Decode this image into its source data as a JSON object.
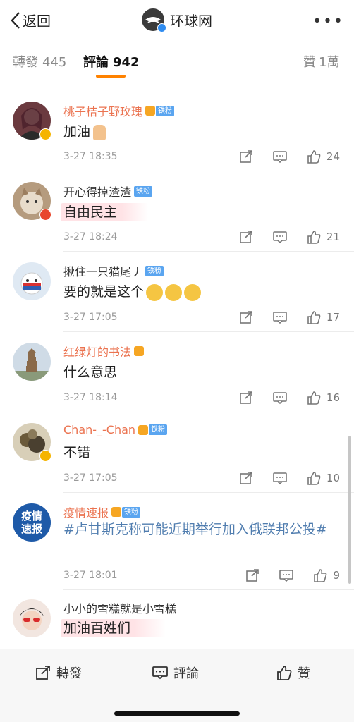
{
  "nav": {
    "back_label": "返回",
    "title": "环球网",
    "more": "•••"
  },
  "tabs": [
    {
      "label": "轉發",
      "count": "445"
    },
    {
      "label": "評論",
      "count": "942"
    },
    {
      "label": "贊",
      "count": "1萬"
    }
  ],
  "comments": [
    {
      "name": "桃子桔子野玫瑰",
      "fan_tag": "铁粉",
      "text": "加油",
      "time": "3-27 18:35",
      "likes": "24"
    },
    {
      "name": "开心得掉渣渣",
      "fan_tag": "铁粉",
      "text": "自由民主",
      "time": "3-27 18:24",
      "likes": "21"
    },
    {
      "name": "揪住一只猫尾丿",
      "fan_tag": "铁粉",
      "text": "要的就是这个",
      "time": "3-27 17:05",
      "likes": "17"
    },
    {
      "name": "红绿灯的书法",
      "text": "什么意思",
      "time": "3-27 18:14",
      "likes": "16"
    },
    {
      "name": "Chan-_-Chan",
      "fan_tag": "铁粉",
      "text": "不错",
      "time": "3-27 17:05",
      "likes": "10"
    },
    {
      "name": "疫情速报",
      "fan_tag": "铁粉",
      "avatar_text": "疫情\n速报",
      "text": "#卢甘斯克称可能近期举行加入俄联邦公投#",
      "time": "3-27 18:01",
      "likes": "9"
    },
    {
      "name": "小小的雪糕就是小雪糕",
      "text": "加油百姓们"
    }
  ],
  "bottom_bar": {
    "repost": "轉發",
    "comment": "評論",
    "like": "贊"
  },
  "colors": {
    "accent": "#ff8200",
    "name_orange": "#eb7350",
    "topic_blue": "#507daf",
    "fan_blue": "#5aa5f0"
  }
}
